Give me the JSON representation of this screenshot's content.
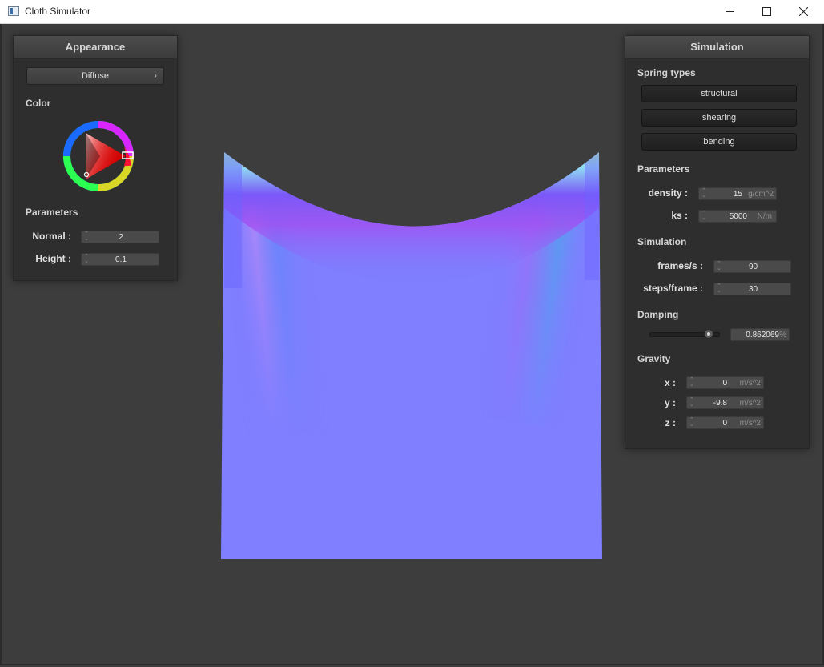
{
  "window": {
    "title": "Cloth Simulator"
  },
  "appearance": {
    "header": "Appearance",
    "shader": "Diffuse",
    "color_label": "Color",
    "color_hex": "#ff0000",
    "parameters_label": "Parameters",
    "normal": {
      "label": "Normal :",
      "value": "2"
    },
    "height": {
      "label": "Height :",
      "value": "0.1"
    }
  },
  "simulation": {
    "header": "Simulation",
    "spring_types_label": "Spring types",
    "springs": [
      "structural",
      "shearing",
      "bending"
    ],
    "parameters_label": "Parameters",
    "density": {
      "label": "density :",
      "value": "15",
      "unit": "g/cm^2"
    },
    "ks": {
      "label": "ks :",
      "value": "5000",
      "unit": "N/m"
    },
    "simulation_label": "Simulation",
    "frames": {
      "label": "frames/s :",
      "value": "90"
    },
    "steps": {
      "label": "steps/frame :",
      "value": "30"
    },
    "damping_label": "Damping",
    "damping": {
      "value": "0.862069",
      "unit": "%",
      "level": 0.862069
    },
    "gravity_label": "Gravity",
    "gx": {
      "label": "x :",
      "value": "0",
      "unit": "m/s^2"
    },
    "gy": {
      "label": "y :",
      "value": "-9.8",
      "unit": "m/s^2"
    },
    "gz": {
      "label": "z :",
      "value": "0",
      "unit": "m/s^2"
    }
  },
  "icons": {
    "minimize": "minimize-icon",
    "maximize": "maximize-icon",
    "close": "close-icon",
    "dropdown": "chevron-right-icon",
    "spinner": "spinner-arrows-icon"
  },
  "colors": {
    "background": "#3d3d3d",
    "panel": "#2e2e2e",
    "cloth_base": "#7f7fff"
  }
}
